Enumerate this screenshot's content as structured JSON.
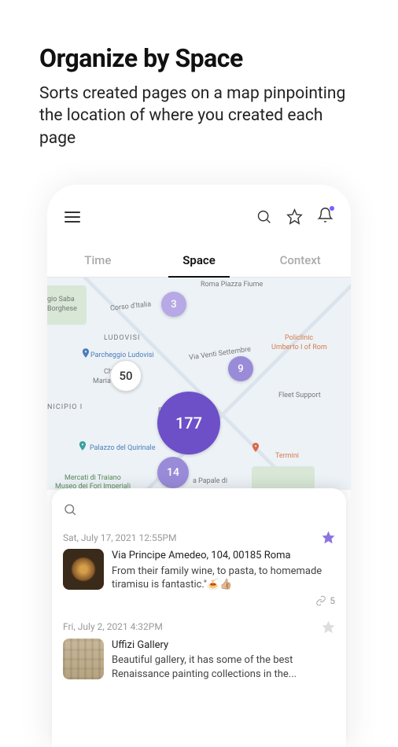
{
  "heading": "Organize by Space",
  "subheading": "Sorts created pages on a map pinpointing the location of where you created each page",
  "tabs": {
    "time": "Time",
    "space": "Space",
    "context": "Context"
  },
  "map": {
    "clusters": {
      "c3": "3",
      "c50": "50",
      "c9": "9",
      "c177": "177",
      "c14": "14"
    },
    "labels": {
      "roma_piazza": "Roma Piazza Fiume",
      "gio_saba": "gio Saba",
      "borghese": "Borghese",
      "corso": "Corso d'Italia",
      "ludovisi": "LUDOVISI",
      "parcheggio": "Parcheggio Ludovisi",
      "via_venti": "Via Venti Settembre",
      "policlinico": "Policlinic",
      "umberto": "Umberto I of Rom",
      "chi": "Chi",
      "maria": "Maria",
      "nicipio": "NICIPIO I",
      "r": "R",
      "fleet": "Fleet Support",
      "palazzo": "Palazzo del Quirinale",
      "termini": "Termini",
      "mercati": "Mercati di Traiano",
      "museo": "Museo dei Fori Imperiali",
      "papale": "a Papale di"
    }
  },
  "entries": [
    {
      "date": "Sat, July 17, 2021 12:55PM",
      "starred": true,
      "title": "Via Principe Amedeo, 104, 00185 Roma",
      "desc": "From their family wine, to pasta, to homemade tiramisu is fantastic.\"🍝👍🏼",
      "links": "5"
    },
    {
      "date": "Fri, July 2, 2021 4:32PM",
      "starred": false,
      "title": "Uffizi Gallery",
      "desc": "Beautiful gallery, it has some of the best Renaissance painting collections in the...",
      "links": ""
    }
  ]
}
